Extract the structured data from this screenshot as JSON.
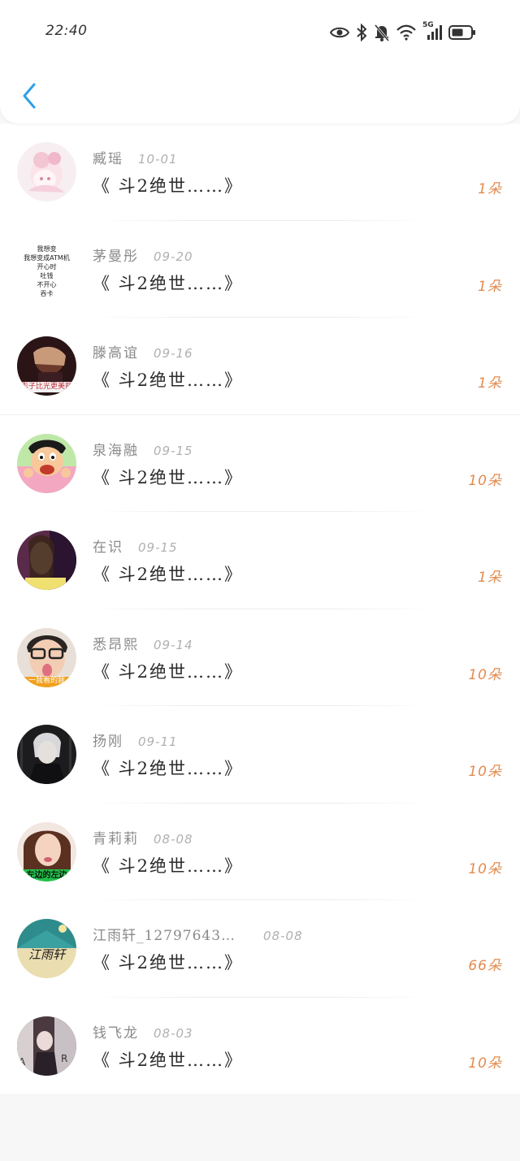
{
  "status_bar": {
    "time": "22:40",
    "network_label": "5G",
    "icons": [
      "eye-icon",
      "bluetooth-icon",
      "bell-muted-icon",
      "wifi-icon",
      "signal-icon",
      "battery-icon"
    ]
  },
  "header": {
    "back_icon": "chevron-left-icon",
    "accent": "#2ea0e8"
  },
  "colors": {
    "flower_count": "#e38a4f",
    "name": "#8a8a8a",
    "date": "#b0b0b0",
    "title": "#2a2a2a"
  },
  "rows": [
    {
      "name": "臧瑶",
      "date": "10-01",
      "title": "《 斗2绝世……》",
      "count": "1朵"
    },
    {
      "name": "茅曼彤",
      "date": "09-20",
      "title": "《 斗2绝世……》",
      "count": "1朵",
      "avatar_text": [
        "我想变",
        "我想变成ATM机",
        "开心时",
        "吐钱",
        "不开心",
        "吞卡"
      ]
    },
    {
      "name": "滕高谊",
      "date": "09-16",
      "title": "《 斗2绝世……》",
      "count": "1朵",
      "avatar_caption": "影子比光更美丽"
    },
    {
      "name": "泉海融",
      "date": "09-15",
      "title": "《 斗2绝世……》",
      "count": "10朵"
    },
    {
      "name": "在识",
      "date": "09-15",
      "title": "《 斗2绝世……》",
      "count": "1朵"
    },
    {
      "name": "悉昂熙",
      "date": "09-14",
      "title": "《 斗2绝世……》",
      "count": "10朵",
      "avatar_caption": "一我看的我"
    },
    {
      "name": "扬刚",
      "date": "09-11",
      "title": "《 斗2绝世……》",
      "count": "10朵"
    },
    {
      "name": "青莉莉",
      "date": "08-08",
      "title": "《 斗2绝世……》",
      "count": "10朵",
      "avatar_caption": "左边的左边"
    },
    {
      "name": "江雨轩_12797643…",
      "date": "08-08",
      "title": "《 斗2绝世……》",
      "count": "66朵",
      "avatar_caption": "江雨轩"
    },
    {
      "name": "钱飞龙",
      "date": "08-03",
      "title": "《 斗2绝世……》",
      "count": "10朵"
    }
  ]
}
